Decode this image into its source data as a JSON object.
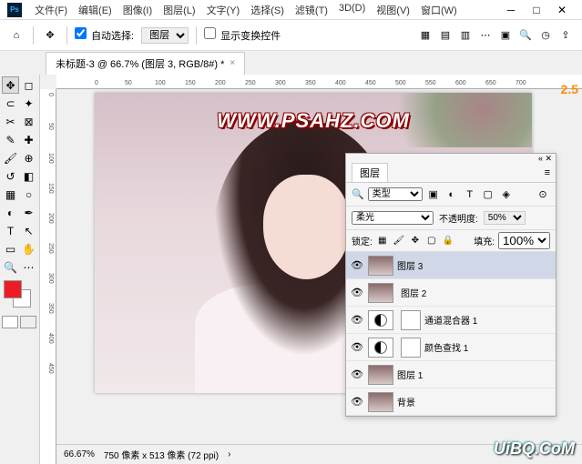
{
  "menu": [
    "文件(F)",
    "编辑(E)",
    "图像(I)",
    "图层(L)",
    "文字(Y)",
    "选择(S)",
    "滤镜(T)",
    "3D(D)",
    "视图(V)",
    "窗口(W)"
  ],
  "options": {
    "auto_select_label": "自动选择:",
    "auto_select_value": "图层",
    "show_transform_label": "显示变换控件"
  },
  "doc_tab": "未标题-3 @ 66.7% (图层 3, RGB/8#) *",
  "ruler_h": [
    "0",
    "50",
    "100",
    "150",
    "200",
    "250",
    "300",
    "350",
    "400",
    "450",
    "500",
    "550",
    "600",
    "650",
    "700"
  ],
  "ruler_v": [
    "0",
    "50",
    "100",
    "150",
    "200",
    "250",
    "300",
    "350",
    "400",
    "450"
  ],
  "watermark": "WWW.PSAHZ.COM",
  "status": {
    "zoom": "66.67%",
    "dims": "750 像素 x 513 像素 (72 ppi)"
  },
  "version_badge": "2.5",
  "layers_panel": {
    "title": "图层",
    "filter_kind": "类型",
    "blend_mode": "柔光",
    "opacity_label": "不透明度:",
    "opacity_value": "50%",
    "lock_label": "锁定:",
    "fill_label": "填充:",
    "fill_value": "100%",
    "layers": [
      {
        "name": "图层 3",
        "type": "photo",
        "selected": true
      },
      {
        "name": "图层 2",
        "type": "photo-smart"
      },
      {
        "name": "通道混合器 1",
        "type": "adjustment"
      },
      {
        "name": "颜色查找 1",
        "type": "adjustment"
      },
      {
        "name": "图层 1",
        "type": "photo"
      },
      {
        "name": "背景",
        "type": "photo"
      }
    ]
  },
  "uibq": "UiBQ.CoM"
}
